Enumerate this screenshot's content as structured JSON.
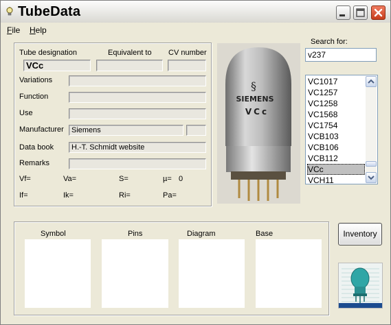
{
  "window": {
    "title": "TubeData"
  },
  "menu": {
    "file": "File",
    "help": "Help"
  },
  "details": {
    "designation_label": "Tube designation",
    "designation_value": "VCc",
    "equivalent_label": "Equivalent to",
    "equivalent_value": "",
    "cv_label": "CV number",
    "cv_value": "",
    "rows": [
      {
        "label": "Variations",
        "value": ""
      },
      {
        "label": "Function",
        "value": ""
      },
      {
        "label": "Use",
        "value": ""
      },
      {
        "label": "Manufacturer",
        "value": "Siemens",
        "extra": ""
      },
      {
        "label": "Data book",
        "value": "H.-T. Schmidt website"
      },
      {
        "label": "Remarks",
        "value": ""
      }
    ],
    "params": [
      {
        "label": "Vf=",
        "value": ""
      },
      {
        "label": "Va=",
        "value": ""
      },
      {
        "label": "S=",
        "value": ""
      },
      {
        "label": "µ=",
        "value": "0"
      },
      {
        "label": "If=",
        "value": ""
      },
      {
        "label": "Ik=",
        "value": ""
      },
      {
        "label": "Ri=",
        "value": ""
      },
      {
        "label": "Pa=",
        "value": ""
      }
    ]
  },
  "photo": {
    "brand_text": "SIEMENS",
    "model_text": "VCc"
  },
  "search": {
    "label": "Search for:",
    "value": "v237"
  },
  "list": {
    "items": [
      "VC1017",
      "VC1257",
      "VC1258",
      "VC1568",
      "VC1754",
      "VCB103",
      "VCB106",
      "VCB112",
      "VCc",
      "VCH11"
    ],
    "selected": "VCc"
  },
  "bottom": {
    "symbol": "Symbol",
    "pins": "Pins",
    "diagram": "Diagram",
    "base": "Base"
  },
  "buttons": {
    "inventory": "Inventory"
  },
  "icons": {
    "title": "lightbulb-icon",
    "minimize": "minimize-icon",
    "maximize": "maximize-icon",
    "close": "close-icon",
    "scroll_up": "chevron-up-icon",
    "scroll_down": "chevron-down-icon",
    "logo": "tube-logo-icon"
  },
  "colors": {
    "close_button": "#c63b1a",
    "list_border": "#7f9db9",
    "logo_teal": "#2fa6a6"
  }
}
